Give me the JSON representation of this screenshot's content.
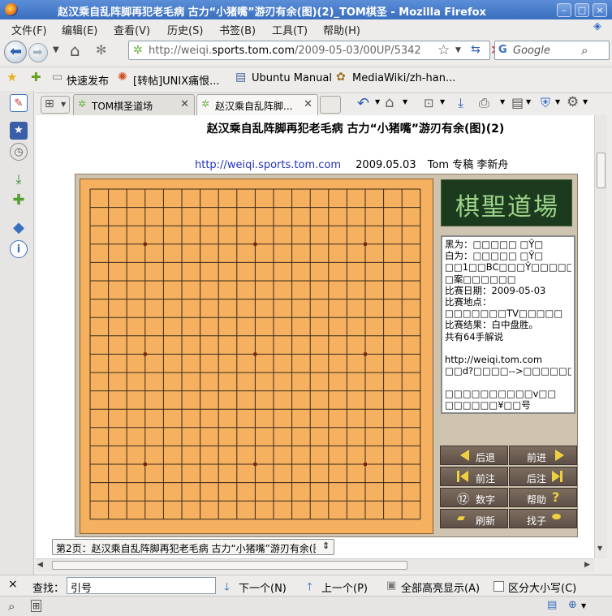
{
  "window": {
    "title": "赵汉乘自乱阵脚再犯老毛病 古力“小猪嘴”游刃有余(图)(2)_TOM棋圣 - Mozilla Firefox",
    "minimize": "–",
    "maximize": "□",
    "close": "×"
  },
  "menu": {
    "items": [
      "文件(F)",
      "编辑(E)",
      "查看(V)",
      "历史(S)",
      "书签(B)",
      "工具(T)",
      "帮助(H)"
    ]
  },
  "nav": {
    "url_prefix": "http://weiqi.",
    "url_domain": "sports.tom.com",
    "url_path": "/2009-05-03/00UP/5342",
    "search_placeholder": "Google"
  },
  "bookmarks": {
    "items": [
      "快速发布",
      "[转帖]UNIX痛恨...",
      "Ubuntu Manual",
      "MediaWiki/zh-han..."
    ]
  },
  "tabs": {
    "items": [
      {
        "label": "TOM棋圣道场"
      },
      {
        "label": "赵汉乘自乱阵脚..."
      }
    ]
  },
  "article": {
    "title": "赵汉乘自乱阵脚再犯老毛病 古力“小猪嘴”游刃有余(图)(2)",
    "link": "http://weiqi.sports.tom.com",
    "date": "2009.05.03",
    "author": "Tom 专稿 李新舟"
  },
  "logo": {
    "text": "棋聖道場"
  },
  "info": {
    "lines": [
      "黑为：□□□□□ □Ŷ□",
      "白为：□□□□□ □Ŷ□",
      "□□1□□BC□□□Ŷ□□□□□□□□",
      "□案□□□□□□",
      "比赛日期：2009-05-03",
      "比赛地点：",
      "□□□□□□□TV□□□□□",
      "比赛结果：白中盘胜。",
      "共有64手解说",
      "",
      "http://weiqi.tom.com",
      "□□d?□□□□-->□□□□□□□",
      "",
      "□□□□□□□□□□v□□",
      "□□□□□□¥□□号"
    ]
  },
  "controls": {
    "back": "后退",
    "forward": "前进",
    "prev_note": "前注",
    "next_note": "后注",
    "number_icon": "⑫",
    "number": "数字",
    "help": "帮助",
    "help_icon": "?",
    "refresh": "刷新",
    "find_stone": "找子"
  },
  "board": {
    "size": 19,
    "star_points": [
      [
        3,
        3
      ],
      [
        3,
        9
      ],
      [
        3,
        15
      ],
      [
        9,
        3
      ],
      [
        9,
        9
      ],
      [
        9,
        15
      ],
      [
        15,
        3
      ],
      [
        15,
        9
      ],
      [
        15,
        15
      ]
    ]
  },
  "page_select": {
    "value": "第2页：赵汉乘自乱阵脚再犯老毛病 古力“小猪嘴”游刃有余(图)"
  },
  "findbar": {
    "close": "×",
    "label": "查找：",
    "value": "引号",
    "next": "下一个(N)",
    "prev": "上一个(P)",
    "highlight": "全部高亮显示(A)",
    "match_case": "区分大小写(C)"
  },
  "colors": {
    "board": "#f5b060",
    "panel": "#cec4b0",
    "title_bar": "#3a6fc0"
  }
}
